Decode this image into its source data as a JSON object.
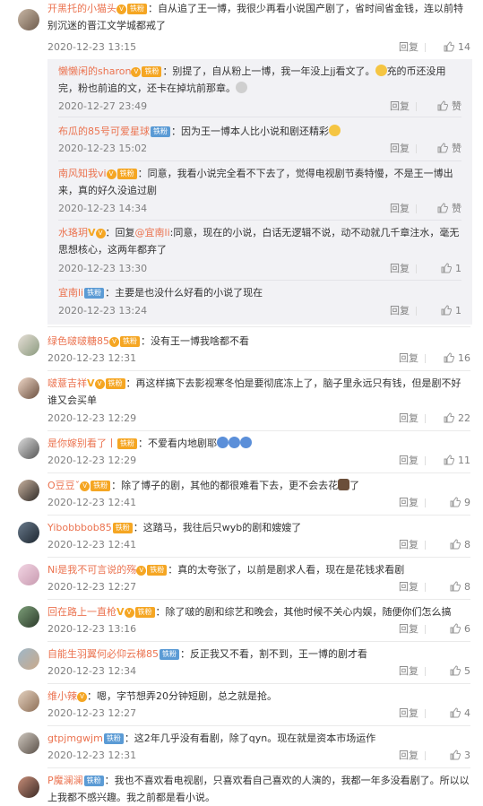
{
  "reply_label": "回复",
  "comments": [
    {
      "name": "开黑托的小猫头",
      "badge": "铁粉",
      "text": "：自从追了王一博，我很少再看小说国产剧了，省时间省金钱，连以前特别沉迷的晋江文学城都戒了",
      "time": "2020-12-23 13:15",
      "likes": "14"
    },
    {
      "name": "绿色啵啵糖85",
      "badge": "铁粉",
      "text": "：没有王一博我啥都不看",
      "time": "2020-12-23 12:31",
      "likes": "16"
    },
    {
      "name": "啵薏吉祥",
      "badge": "铁粉",
      "text": "：再这样搞下去影视寒冬怕是要彻底冻上了，脑子里永远只有钱，但是剧不好谁又会买单",
      "time": "2020-12-23 12:29",
      "likes": "22"
    },
    {
      "name": "是你嫁别看了丨",
      "badge": "铁粉",
      "text": "：不爱看内地剧耶",
      "time": "2020-12-23 12:29",
      "likes": "11"
    },
    {
      "name": "O豆豆ˇ",
      "badge": "铁粉",
      "text": "：除了博子的剧，其他的都很难看下去，更不会去花",
      "text2": "了",
      "time": "2020-12-23 12:41",
      "likes": "9"
    },
    {
      "name": "Yibobbbob85",
      "badge": "铁粉",
      "text": "：这踏马，我往后只wyb的剧和嫂嫂了",
      "time": "2020-12-23 12:41",
      "likes": "8"
    },
    {
      "name": "Ni是我不可言说的殇",
      "badge": "铁粉",
      "text": "：真的太夸张了，以前是剧求人看，现在是花钱求看剧",
      "time": "2020-12-23 12:27",
      "likes": "8"
    },
    {
      "name": "回在路上一直枪",
      "badge": "铁粉",
      "text": "：除了啵的剧和综艺和晚会，其他时候不关心内娱，随便你们怎么搞",
      "time": "2020-12-23 13:16",
      "likes": "6"
    },
    {
      "name": "自能生羽翼何必仰云梯85",
      "badge": "铁粉",
      "text": "：反正我又不看，割不到，王一博的剧才看",
      "time": "2020-12-23 12:34",
      "likes": "5"
    },
    {
      "name": "维小辣",
      "badge": "",
      "text": "：嗯，字节想弄20分钟短剧，总之就是抢。",
      "time": "2020-12-23 12:27",
      "likes": "4"
    },
    {
      "name": "gtpjmgwjm",
      "badge": "铁粉",
      "text": "：这2年几乎没有看剧，除了qyn。现在就是资本市场运作",
      "time": "2020-12-23 12:31",
      "likes": "3"
    },
    {
      "name": "P魔澜澜",
      "badge": "铁粉",
      "text": "：我也不喜欢看电视剧，只喜欢看自己喜欢的人演的，我都一年多没看剧了。所以以上我都不感兴趣。我之前都是看小说。",
      "time": "",
      "likes": ""
    }
  ],
  "replies": [
    {
      "name": "懒懒闲的sharon",
      "badge": "铁粉",
      "text": "：别提了，自从粉上一博，我一年没上jj看文了。",
      "text2": "充的币还没用完，粉也前追的文，还卡在掉坑前那章。",
      "time": "2020-12-27 23:49",
      "likes": "赞"
    },
    {
      "name": "布瓜的85号可爱星球",
      "badge": "铁粉",
      "text": "：因为王一博本人比小说和剧还精彩",
      "time": "2020-12-23 15:02",
      "likes": "赞"
    },
    {
      "name": "南风知我vi",
      "badge": "铁粉",
      "text": "：同意，我看小说完全看不下去了，觉得电视剧节奏特慢，不是王一博出来，真的好久没追过剧",
      "time": "2020-12-23 14:34",
      "likes": "赞"
    },
    {
      "name": "水珞玥",
      "badge": "",
      "text": "：回复",
      "mention": "@宜南li",
      "text2": ":同意，现在的小说，白话无逻辑不说，动不动就几千章注水，毫无思想核心，这两年都弃了",
      "time": "2020-12-23 13:30",
      "likes": "1"
    },
    {
      "name": "宜南li",
      "badge": "铁粉",
      "text": "：主要是也没什么好看的小说了现在",
      "time": "2020-12-23 13:24",
      "likes": "1"
    }
  ]
}
